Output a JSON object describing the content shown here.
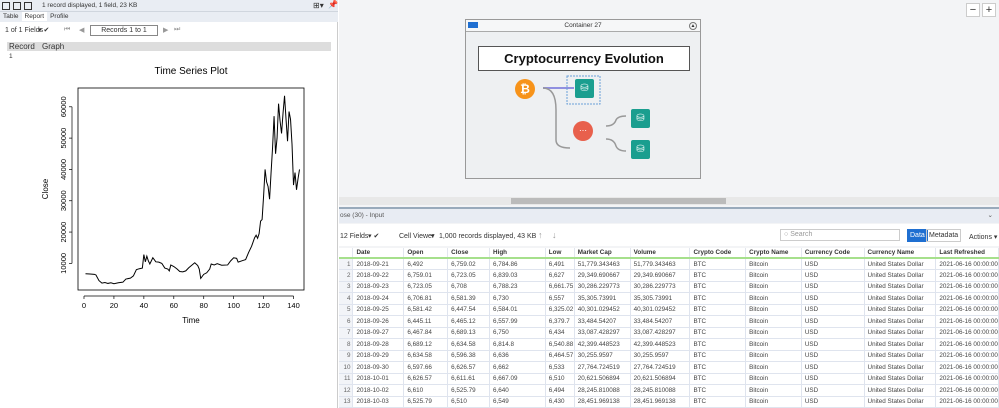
{
  "left_panel": {
    "status": "1 record displayed, 1 field, 23 KB",
    "tabs": [
      "Table",
      "Report",
      "Profile"
    ],
    "fields": "1 of 1 Fields",
    "records": "Records 1 to 1",
    "col_record": "Record",
    "col_graph": "Graph",
    "row_value": "1"
  },
  "chart_data": {
    "type": "line",
    "title": "Time Series Plot",
    "xlabel": "Time",
    "ylabel": "Close",
    "xlim": [
      -4,
      147
    ],
    "ylim": [
      1500,
      66000
    ],
    "xticks": [
      0,
      20,
      40,
      60,
      80,
      100,
      120,
      140
    ],
    "yticks": [
      10000,
      20000,
      30000,
      40000,
      50000,
      60000
    ],
    "points": [
      [
        1,
        6700
      ],
      [
        4,
        6600
      ],
      [
        7,
        6500
      ],
      [
        8,
        6300
      ],
      [
        10,
        4500
      ],
      [
        12,
        3700
      ],
      [
        14,
        3900
      ],
      [
        16,
        3600
      ],
      [
        18,
        3800
      ],
      [
        20,
        3500
      ],
      [
        23,
        3800
      ],
      [
        26,
        4000
      ],
      [
        28,
        5000
      ],
      [
        31,
        5300
      ],
      [
        33,
        6000
      ],
      [
        35,
        8000
      ],
      [
        37,
        8300
      ],
      [
        39,
        8500
      ],
      [
        40,
        12800
      ],
      [
        41,
        10500
      ],
      [
        42,
        12300
      ],
      [
        43,
        10800
      ],
      [
        44,
        9800
      ],
      [
        46,
        11800
      ],
      [
        48,
        10500
      ],
      [
        50,
        10400
      ],
      [
        52,
        10000
      ],
      [
        54,
        8500
      ],
      [
        56,
        8200
      ],
      [
        57,
        7600
      ],
      [
        58,
        9500
      ],
      [
        60,
        9000
      ],
      [
        62,
        8300
      ],
      [
        64,
        7400
      ],
      [
        66,
        7300
      ],
      [
        68,
        7600
      ],
      [
        70,
        8600
      ],
      [
        72,
        9400
      ],
      [
        74,
        10200
      ],
      [
        76,
        9300
      ],
      [
        77,
        8200
      ],
      [
        78,
        5200
      ],
      [
        80,
        6500
      ],
      [
        82,
        7000
      ],
      [
        84,
        8200
      ],
      [
        85,
        9800
      ],
      [
        87,
        9500
      ],
      [
        89,
        9900
      ],
      [
        92,
        9400
      ],
      [
        96,
        9500
      ],
      [
        98,
        10800
      ],
      [
        100,
        11800
      ],
      [
        102,
        11600
      ],
      [
        103,
        10400
      ],
      [
        106,
        10900
      ],
      [
        108,
        11200
      ],
      [
        110,
        13500
      ],
      [
        112,
        15500
      ],
      [
        114,
        18200
      ],
      [
        115,
        19000
      ],
      [
        116,
        18000
      ],
      [
        117,
        19500
      ],
      [
        118,
        23500
      ],
      [
        119,
        24000
      ],
      [
        120,
        31500
      ],
      [
        121,
        40000
      ],
      [
        122,
        36000
      ],
      [
        123,
        34500
      ],
      [
        124,
        30500
      ],
      [
        125,
        39000
      ],
      [
        126,
        47000
      ],
      [
        127,
        57000
      ],
      [
        128,
        45000
      ],
      [
        129,
        50000
      ],
      [
        130,
        61000
      ],
      [
        131,
        55500
      ],
      [
        132,
        51500
      ],
      [
        133,
        58000
      ],
      [
        134,
        63500
      ],
      [
        135,
        56000
      ],
      [
        136,
        49000
      ],
      [
        137,
        58500
      ],
      [
        138,
        56000
      ],
      [
        139,
        48000
      ],
      [
        140,
        35000
      ],
      [
        141,
        39000
      ],
      [
        142,
        33500
      ],
      [
        143,
        37000
      ],
      [
        144,
        40000
      ]
    ]
  },
  "canvas": {
    "container_title": "Container 27",
    "workflow_title": "Cryptocurrency Evolution",
    "zoom_out": "−",
    "zoom_in": "+"
  },
  "results": {
    "header": "ose (30) - Input",
    "fields": "12 Fields",
    "cell_viewer": "Cell Viewer",
    "records": "1,000 records displayed, 43 KB",
    "search_placeholder": "Search",
    "data_btn": "Data",
    "metadata_btn": "Metadata",
    "actions": "Actions",
    "columns": [
      "Date",
      "Open",
      "Close",
      "High",
      "Low",
      "Market Cap",
      "Volume",
      "Crypto Code",
      "Crypto Name",
      "Currency Code",
      "Currency Name",
      "Last Refreshed"
    ],
    "rows": [
      [
        "2018-09-21",
        "6,492",
        "6,759.02",
        "6,784.86",
        "6,491",
        "51,779.343463",
        "51,779.343463",
        "BTC",
        "Bitcoin",
        "USD",
        "United States Dollar",
        "2021-06-16 00:00:00"
      ],
      [
        "2018-09-22",
        "6,759.01",
        "6,723.05",
        "6,839.03",
        "6,627",
        "29,349.690667",
        "29,349.690667",
        "BTC",
        "Bitcoin",
        "USD",
        "United States Dollar",
        "2021-06-16 00:00:00"
      ],
      [
        "2018-09-23",
        "6,723.05",
        "6,708",
        "6,788.23",
        "6,661.75",
        "30,286.229773",
        "30,286.229773",
        "BTC",
        "Bitcoin",
        "USD",
        "United States Dollar",
        "2021-06-16 00:00:00"
      ],
      [
        "2018-09-24",
        "6,706.81",
        "6,581.39",
        "6,730",
        "6,557",
        "35,305.73991",
        "35,305.73991",
        "BTC",
        "Bitcoin",
        "USD",
        "United States Dollar",
        "2021-06-16 00:00:00"
      ],
      [
        "2018-09-25",
        "6,581.42",
        "6,447.54",
        "6,584.01",
        "6,325.02",
        "40,301.029452",
        "40,301.029452",
        "BTC",
        "Bitcoin",
        "USD",
        "United States Dollar",
        "2021-06-16 00:00:00"
      ],
      [
        "2018-09-26",
        "6,445.11",
        "6,465.12",
        "6,557.99",
        "6,379.7",
        "33,484.54207",
        "33,484.54207",
        "BTC",
        "Bitcoin",
        "USD",
        "United States Dollar",
        "2021-06-16 00:00:00"
      ],
      [
        "2018-09-27",
        "6,467.84",
        "6,689.13",
        "6,750",
        "6,434",
        "33,087.428297",
        "33,087.428297",
        "BTC",
        "Bitcoin",
        "USD",
        "United States Dollar",
        "2021-06-16 00:00:00"
      ],
      [
        "2018-09-28",
        "6,689.12",
        "6,634.58",
        "6,814.8",
        "6,540.88",
        "42,399.448523",
        "42,399.448523",
        "BTC",
        "Bitcoin",
        "USD",
        "United States Dollar",
        "2021-06-16 00:00:00"
      ],
      [
        "2018-09-29",
        "6,634.58",
        "6,596.38",
        "6,636",
        "6,464.57",
        "30,255.9597",
        "30,255.9597",
        "BTC",
        "Bitcoin",
        "USD",
        "United States Dollar",
        "2021-06-16 00:00:00"
      ],
      [
        "2018-09-30",
        "6,597.66",
        "6,626.57",
        "6,662",
        "6,533",
        "27,764.724519",
        "27,764.724519",
        "BTC",
        "Bitcoin",
        "USD",
        "United States Dollar",
        "2021-06-16 00:00:00"
      ],
      [
        "2018-10-01",
        "6,626.57",
        "6,611.61",
        "6,667.09",
        "6,510",
        "20,621.506894",
        "20,621.506894",
        "BTC",
        "Bitcoin",
        "USD",
        "United States Dollar",
        "2021-06-16 00:00:00"
      ],
      [
        "2018-10-02",
        "6,610",
        "6,525.79",
        "6,640",
        "6,494",
        "28,245.810088",
        "28,245.810088",
        "BTC",
        "Bitcoin",
        "USD",
        "United States Dollar",
        "2021-06-16 00:00:00"
      ],
      [
        "2018-10-03",
        "6,525.79",
        "6,510",
        "6,549",
        "6,430",
        "28,451.969138",
        "28,451.969138",
        "BTC",
        "Bitcoin",
        "USD",
        "United States Dollar",
        "2021-06-16 00:00:00"
      ]
    ]
  },
  "colors": {
    "accent": "#1f6fd1",
    "tool_green": "#1a9e8f",
    "bitcoin": "#f7931a",
    "parse": "#e8604c",
    "connector": "#a6d94f"
  }
}
